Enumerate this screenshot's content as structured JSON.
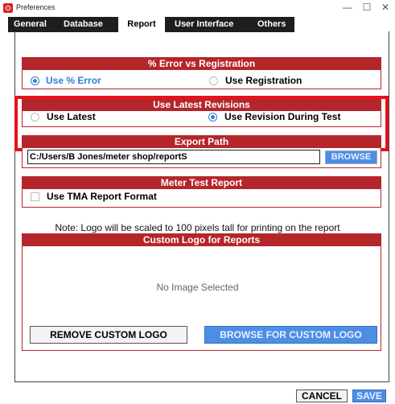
{
  "window": {
    "title": "Preferences",
    "minimize": "—",
    "maximize": "☐",
    "close": "✕"
  },
  "tabs": [
    "General",
    "Database",
    "Report",
    "User Interface",
    "Others"
  ],
  "active_tab": "Report",
  "error_section": {
    "title": "% Error vs Registration",
    "option_a": "Use % Error",
    "option_b": "Use Registration",
    "selected": "Use % Error"
  },
  "revisions_section": {
    "title": "Use Latest Revisions",
    "option_a": "Use Latest",
    "option_b": "Use Revision During Test",
    "selected": "Use Revision During Test"
  },
  "export_section": {
    "title": "Export Path",
    "path_value": "C:/Users/B Jones/meter shop/reportS",
    "browse_label": "BROWSE"
  },
  "meter_section": {
    "title": "Meter Test Report",
    "checkbox_label": "Use TMA Report Format",
    "checked": false
  },
  "note": "Note: Logo will be scaled to 100 pixels tall for printing on the report",
  "logo_section": {
    "title": "Custom Logo for Reports",
    "empty_text": "No Image Selected",
    "remove_label": "REMOVE CUSTOM LOGO",
    "browse_label": "BROWSE FOR CUSTOM LOGO"
  },
  "footer": {
    "cancel_label": "CANCEL",
    "save_label": "SAVE"
  },
  "colors": {
    "accent_red": "#b5262b",
    "highlight_red": "#e8101a",
    "button_blue": "#4d8ee5",
    "radio_blue": "#2e7fd6"
  }
}
